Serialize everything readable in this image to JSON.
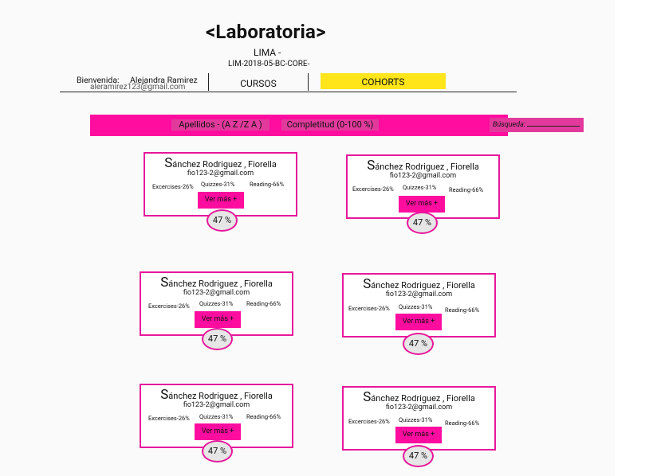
{
  "brand": {
    "logo_text": "<Laboratoria>"
  },
  "header": {
    "city": "LIMA -",
    "cohort_code": "LIM-2018-05-BC-CORE-",
    "welcome_label": "Bienvenida:",
    "user_name": "Alejandra Ramirez",
    "user_email": "aleramirez123@gmail.com"
  },
  "nav": {
    "cursos_label": "CURSOS",
    "cohorts_label": "COHORTS",
    "active_color": "#ffe51a"
  },
  "filters": {
    "sort_name_label": "Apellidos - (A Z /Z A )",
    "sort_completion_label": "Completitud (0-100 %)",
    "search_label": "Búsqueda:"
  },
  "colors": {
    "accent": "#ff0d9f",
    "border": "#e6189a",
    "button_bg": "#e23a9c"
  },
  "cards": [
    {
      "name_initial": "S",
      "name_rest": "ánchez Rodriguez , Fiorella",
      "email": "fio123-2@gmail.com",
      "exercises": "Excercises-26%",
      "quizzes": "Quizzes-31%",
      "reading": "Reading-66%",
      "button": "Ver más +",
      "percent": "47 %"
    },
    {
      "name_initial": "S",
      "name_rest": "ánchez Rodriguez , Fiorella",
      "email": "fio123-2@gmail.com",
      "exercises": "Excercises-26%",
      "quizzes": "Quizzes-31%",
      "reading": "Reading-66%",
      "button": "Ver más +",
      "percent": "47 %"
    },
    {
      "name_initial": "S",
      "name_rest": "ánchez Rodriguez , Fiorella",
      "email": "fio123-2@gmail.com",
      "exercises": "Excercises-26%",
      "quizzes": "Quizzes-31%",
      "reading": "Reading-66%",
      "button": "Ver más +",
      "percent": "47 %"
    },
    {
      "name_initial": "S",
      "name_rest": "ánchez Rodriguez , Fiorella",
      "email": "fio123-2@gmail.com",
      "exercises": "Excercises-26%",
      "quizzes": "Quizzes-31%",
      "reading": "Reading-66%",
      "button": "Ver más +",
      "percent": "47 %"
    },
    {
      "name_initial": "S",
      "name_rest": "ánchez Rodriguez , Fiorella",
      "email": "fio123-2@gmail.com",
      "exercises": "Excercises-26%",
      "quizzes": "Quizzes-31%",
      "reading": "Reading-66%",
      "button": "Ver más +",
      "percent": "47 %"
    },
    {
      "name_initial": "S",
      "name_rest": "ánchez Rodriguez , Fiorella",
      "email": "fio123-2@gmail.com",
      "exercises": "Excercises-26%",
      "quizzes": "Quizzes-31%",
      "reading": "Reading-66%",
      "button": "Ver más +",
      "percent": "47 %"
    }
  ]
}
